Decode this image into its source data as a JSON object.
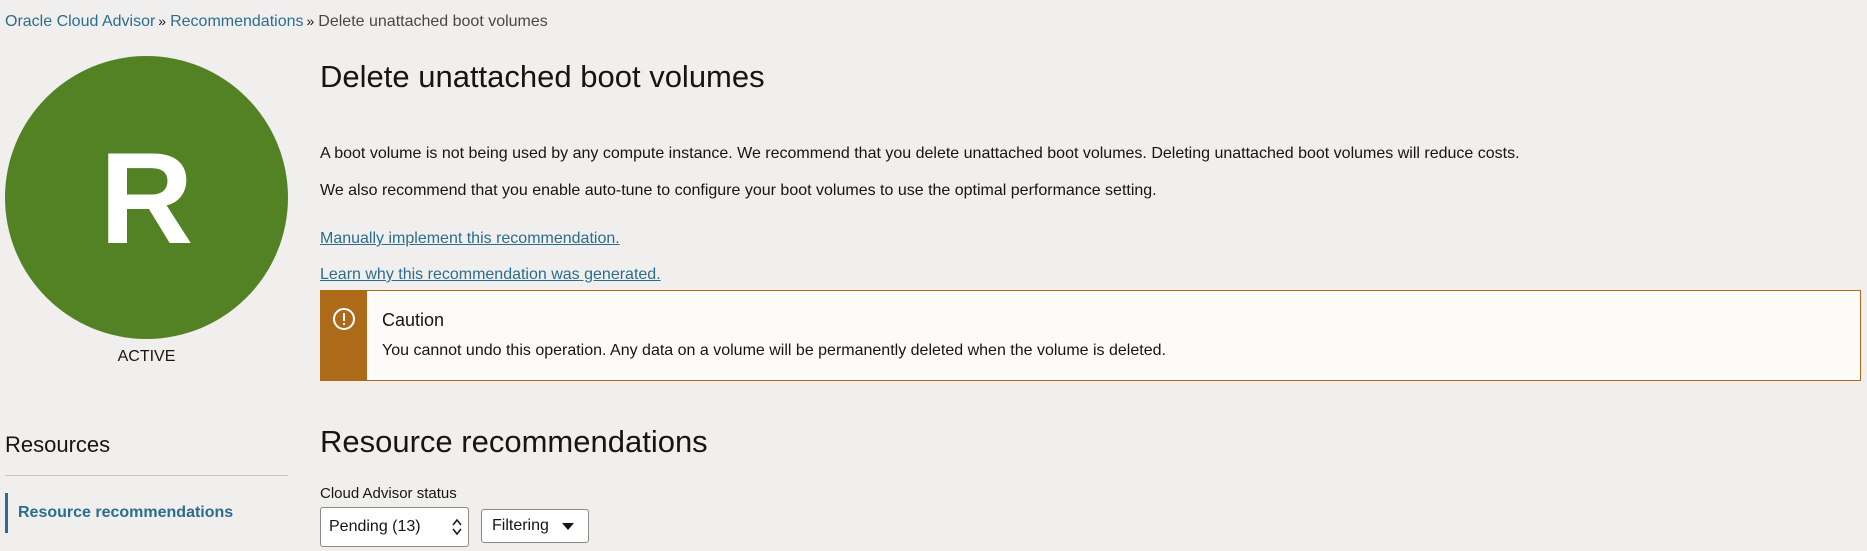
{
  "breadcrumb": {
    "items": [
      "Oracle Cloud Advisor",
      "Recommendations"
    ],
    "current": "Delete unattached boot volumes",
    "separator": "»"
  },
  "avatar": {
    "letter": "R",
    "status": "ACTIVE",
    "color": "#538225"
  },
  "resources": {
    "heading": "Resources",
    "nav_item": "Resource recommendations"
  },
  "main": {
    "title": "Delete unattached boot volumes",
    "description_1": "A boot volume is not being used by any compute instance. We recommend that you delete unattached boot volumes. Deleting unattached boot volumes will reduce costs.",
    "description_2": "We also recommend that you enable auto-tune to configure your boot volumes to use the optimal performance setting.",
    "link_manual": "Manually implement this recommendation.",
    "link_learn": "Learn why this recommendation was generated."
  },
  "caution": {
    "title": "Caution",
    "text": "You cannot undo this operation. Any data on a volume will be permanently deleted when the volume is deleted.",
    "icon": "exclamation-circle-icon",
    "color": "#ad6a18"
  },
  "resource_recommendations": {
    "title": "Resource recommendations",
    "filter_label": "Cloud Advisor status",
    "status_select_value": "Pending (13)",
    "filter_button": "Filtering"
  },
  "colors": {
    "link": "#2b6d8c",
    "background": "#f1efed"
  }
}
